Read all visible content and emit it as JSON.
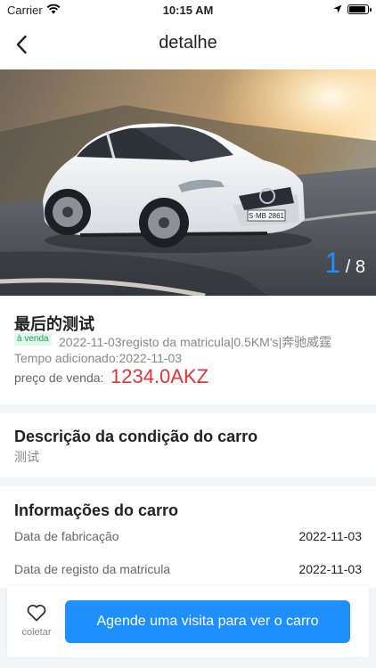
{
  "status": {
    "carrier": "Carrier",
    "time": "10:15 AM"
  },
  "nav": {
    "title": "detalhe"
  },
  "gallery": {
    "current": "1",
    "separator": "/",
    "total": "8",
    "plate": "S·MB 2861"
  },
  "car": {
    "name": "最后的测试",
    "status_badge": "à venda",
    "specs": "2022-11-03registo da matricula|0.5KM's|奔驰威霆",
    "added": "Tempo adicionado:2022-11-03",
    "price_label": "preço de venda:",
    "price": "1234.0AKZ"
  },
  "condition": {
    "heading": "Descrição da condição do carro",
    "text": "测试"
  },
  "info": {
    "heading": "Informações do carro",
    "rows": [
      {
        "label": "Data de fabricação",
        "value": "2022-11-03"
      },
      {
        "label": "Data de registo da matricula",
        "value": "2022-11-03"
      }
    ]
  },
  "footer": {
    "collect_label": "coletar",
    "cta_label": "Agende uma visita para ver o carro"
  },
  "colors": {
    "accent": "#1e8fff",
    "price": "#e8323c",
    "badge_text": "#1aa35b",
    "badge_bg": "#e3f6ea"
  },
  "icons": {
    "back": "chevron-left-icon",
    "favorite": "heart-outline-icon",
    "wifi": "wifi-icon",
    "location": "location-arrow-icon",
    "battery": "battery-icon"
  },
  "battery_level": 0.9
}
